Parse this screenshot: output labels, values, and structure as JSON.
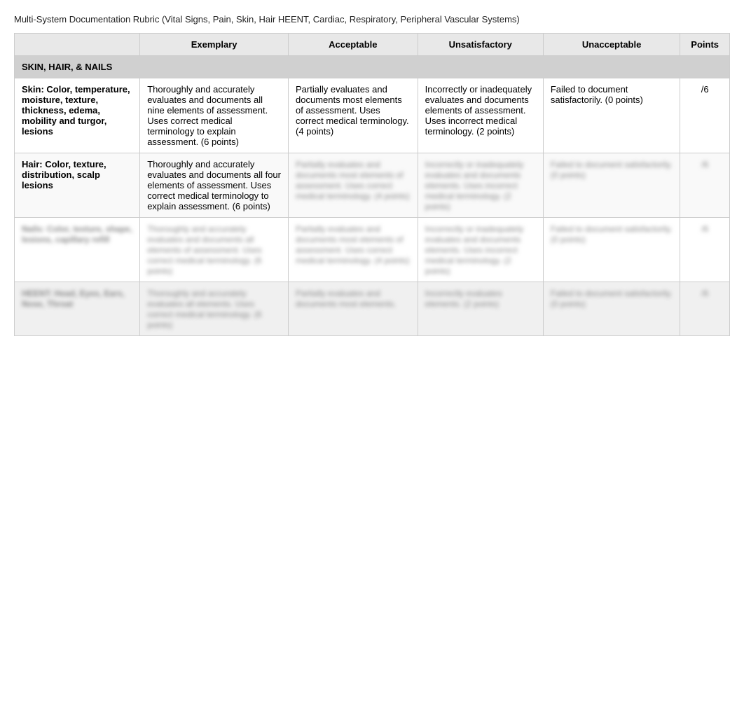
{
  "page": {
    "title": "Multi-System Documentation Rubric (Vital Signs, Pain, Skin, Hair HEENT, Cardiac, Respiratory, Peripheral Vascular Systems)"
  },
  "table": {
    "headers": {
      "criterion": "",
      "exemplary": "Exemplary",
      "acceptable": "Acceptable",
      "unsatisfactory": "Unsatisfactory",
      "unacceptable": "Unacceptable",
      "points": "Points"
    },
    "sections": [
      {
        "id": "skin-hair-nails",
        "category": "SKIN, HAIR, & NAILS",
        "rows": [
          {
            "id": "skin-color",
            "label": "Skin: Color, temperature, moisture, texture, thickness, edema, mobility and turgor, lesions",
            "exemplary": "Thoroughly and accurately evaluates and documents all nine elements of assessment. Uses correct medical terminology to explain assessment. (6 points)",
            "acceptable": "Partially evaluates and documents most elements of assessment. Uses correct medical terminology. (4 points)",
            "unsatisfactory": "Incorrectly or inadequately evaluates and documents elements of assessment. Uses incorrect medical terminology. (2 points)",
            "unacceptable": "Failed to document satisfactorily. (0 points)",
            "points": "/6",
            "blurred": false
          },
          {
            "id": "hair-color",
            "label": "Hair: Color, texture, distribution, scalp lesions",
            "exemplary": "Thoroughly and accurately evaluates and documents all four elements of assessment. Uses correct medical terminology to explain assessment. (6 points)",
            "acceptable": "Partially evaluates and documents most elements of assessment. Uses",
            "unsatisfactory": "[blurred content]",
            "unacceptable": "[blurred content]",
            "points": "",
            "blurred_acceptable": true,
            "blurred_unsatisfactory": true,
            "blurred_unacceptable": true,
            "blurred_points": true
          },
          {
            "id": "nails",
            "label": "[blurred label]",
            "exemplary": "[blurred content]",
            "acceptable": "[blurred content]",
            "unsatisfactory": "[blurred content]",
            "unacceptable": "[blurred content]",
            "points": "",
            "blurred_label": true,
            "blurred": true
          },
          {
            "id": "heent",
            "label": "[blurred label 2]",
            "exemplary": "[blurred content 2]",
            "acceptable": "[blurred content 2]",
            "unsatisfactory": "[blurred content 2]",
            "unacceptable": "[blurred content 2]",
            "points": "",
            "blurred_label": true,
            "blurred": true,
            "alt": true
          }
        ]
      }
    ]
  }
}
